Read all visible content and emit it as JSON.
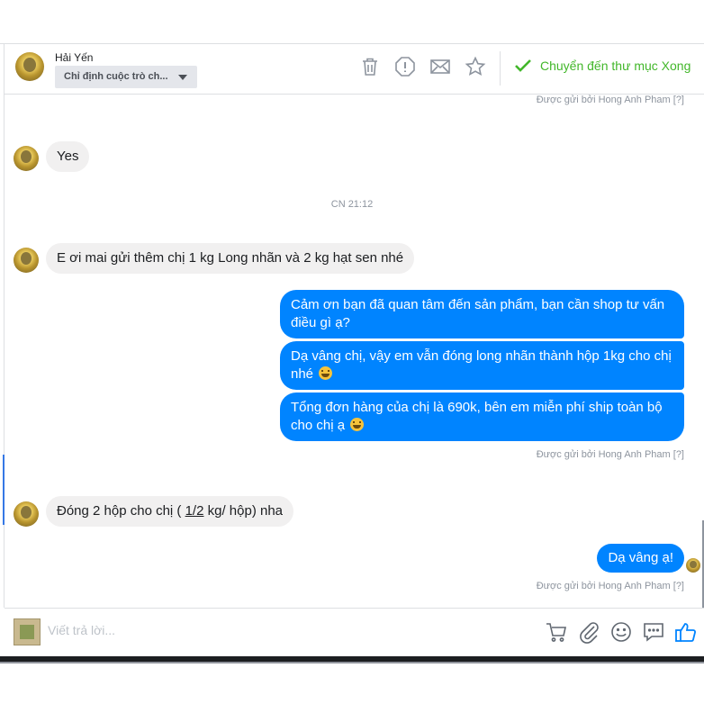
{
  "header": {
    "contact_name": "Hải Yến",
    "assign_label": "Chỉ định cuộc trò ch...",
    "done_label": "Chuyển đến thư mục Xong",
    "icons": [
      "trash-icon",
      "alert-icon",
      "mail-icon",
      "star-icon",
      "check-icon"
    ],
    "accent_color": "#42b72a"
  },
  "conversation": {
    "sent_by_top": "Được gửi bởi Hong Anh Pham [?]",
    "msg_yes": "Yes",
    "timestamp": "CN 21:12",
    "msg_order": "E ơi mai gửi thêm chị 1 kg Long nhãn và 2 kg hạt sen nhé",
    "out1": "Cảm ơn bạn đã quan tâm đến sản phẩm, bạn cần shop tư vấn điều gì ạ?",
    "out2": "Dạ vâng chị, vậy em vẫn đóng long nhãn thành hộp 1kg cho chị nhé",
    "out3": "Tổng đơn hàng của chị là 690k, bên em miễn phí ship toàn bộ cho chị ạ",
    "sent_by_mid": "Được gửi bởi Hong Anh Pham [?]",
    "in_last_pre": "Đóng 2 hộp cho chị ( ",
    "in_last_frac": "1/2",
    "in_last_post": " kg/ hộp) nha",
    "out_last": "Dạ vâng ạ!",
    "sent_by_bottom": "Được gửi bởi Hong Anh Pham [?]",
    "bubble_color": "#0084ff"
  },
  "composer": {
    "placeholder": "Viết trả lời...",
    "icons": [
      "cart-icon",
      "attach-icon",
      "emoji-icon",
      "quick-reply-icon",
      "like-icon"
    ]
  }
}
